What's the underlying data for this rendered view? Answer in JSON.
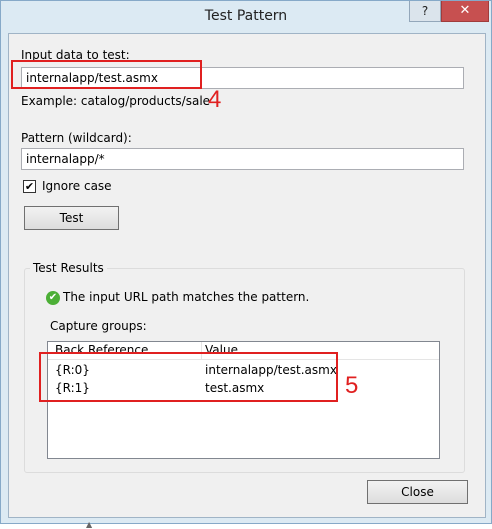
{
  "window": {
    "title": "Test Pattern",
    "help_glyph": "?",
    "close_glyph": "✕"
  },
  "input": {
    "label": "Input data to test:",
    "value": "internalapp/test.asmx",
    "example": "Example: catalog/products/sale"
  },
  "pattern": {
    "label": "Pattern (wildcard):",
    "value": "internalapp/*"
  },
  "ignore_case": {
    "label": "Ignore case",
    "checked": true,
    "check_glyph": "✔"
  },
  "test_button": {
    "label": "Test"
  },
  "results": {
    "title": "Test Results",
    "status_icon": "check-circle-icon",
    "status_text": "The input URL path matches the pattern.",
    "capture_label": "Capture groups:",
    "columns": [
      "Back Reference",
      "Value"
    ],
    "rows": [
      {
        "ref": "{R:0}",
        "value": "internalapp/test.asmx"
      },
      {
        "ref": "{R:1}",
        "value": "test.asmx"
      }
    ]
  },
  "close_button": {
    "label": "Close"
  },
  "annotations": [
    "4",
    "5"
  ],
  "colors": {
    "annotation": "#e02020",
    "success": "#4caf36",
    "close_hover": "#c75050"
  }
}
